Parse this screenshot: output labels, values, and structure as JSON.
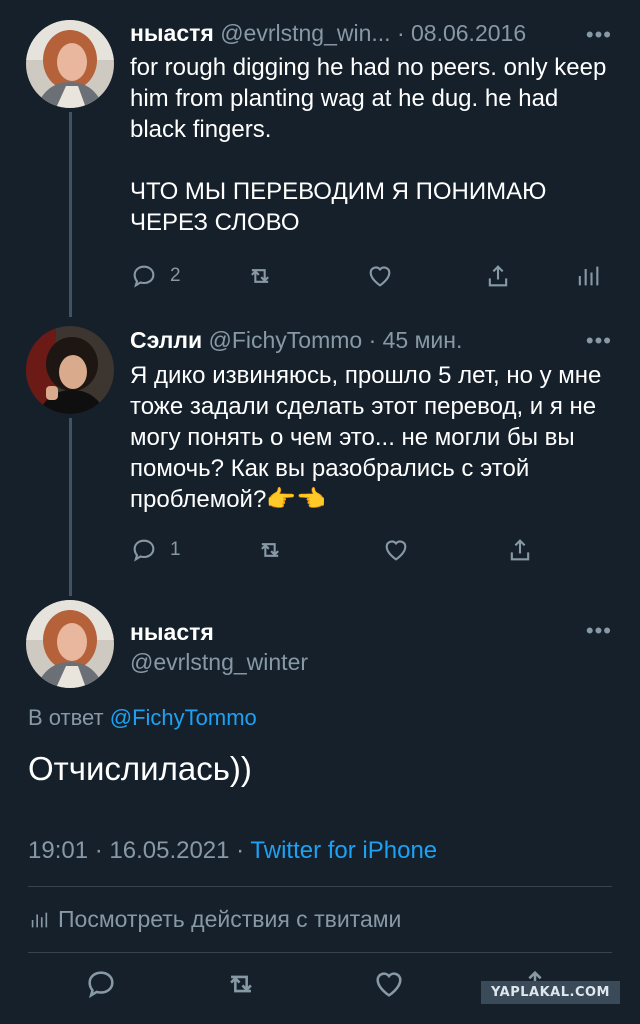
{
  "tweet1": {
    "name": "ныастя",
    "handle": "@evrlstng_win...",
    "date": "· 08.06.2016",
    "text": "for rough digging he had no peers. only keep him from planting wag at he dug. he had black fingers.\n\nЧТО МЫ ПЕРЕВОДИМ Я ПОНИМАЮ ЧЕРЕЗ СЛОВО",
    "reply_count": "2",
    "more": "•••"
  },
  "tweet2": {
    "name": "Сэлли",
    "handle": "@FichyTommo",
    "date": "· 45 мин.",
    "text": "Я дико извиняюсь, прошло 5 лет, но у мне тоже задали сделать этот перевод, и я не могу понять о чем это... не могли бы вы помочь? Как вы разобрались с этой проблемой?👉👈",
    "reply_count": "1",
    "more": "•••"
  },
  "main": {
    "name": "ныастя",
    "handle": "@evrlstng_winter",
    "more": "•••",
    "reply_prefix": "В ответ",
    "reply_mention": "@FichyTommo",
    "text": "Отчислилась))",
    "timestamp": "19:01 · 16.05.2021 ·",
    "source": "Twitter for iPhone",
    "activity": "Посмотреть действия с твитами"
  },
  "watermark": "YAPLAKAL.COM",
  "colors": {
    "background": "#15202b",
    "muted": "#8899a6",
    "link": "#1da1f2",
    "divider": "#38444d"
  }
}
